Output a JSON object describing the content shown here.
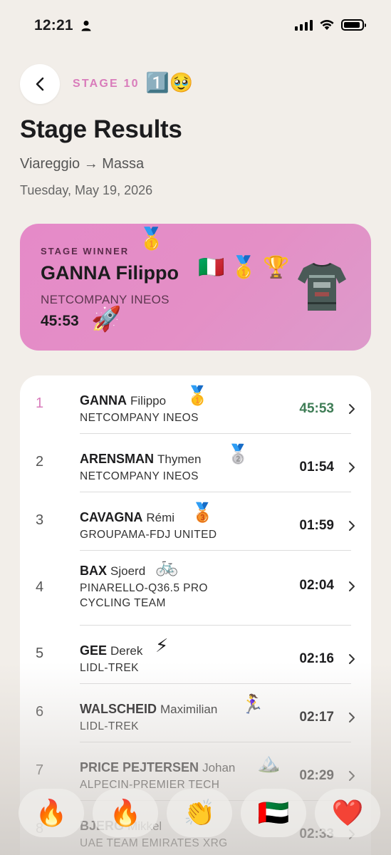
{
  "status_bar": {
    "time": "12:21",
    "battery_level": 0.9
  },
  "header": {
    "stage_label": "STAGE 10",
    "stage_emoji": "1️⃣🥹",
    "title": "Stage Results",
    "route": "Viareggio → Massa",
    "date": "Tuesday, May 19, 2026"
  },
  "winner": {
    "label": "STAGE WINNER",
    "label_medal": "🥇",
    "name": "GANNA Filippo",
    "emojis": "🇮🇹 🥇 🏆",
    "team": "NETCOMPANY INEOS",
    "time": "45:53",
    "time_emoji": "🚀"
  },
  "results": [
    {
      "rank": "1",
      "surname": "GANNA",
      "firstname": "Filippo",
      "emoji": "🥇",
      "team": "NETCOMPANY INEOS",
      "team2": "",
      "time": "45:53"
    },
    {
      "rank": "2",
      "surname": "ARENSMAN",
      "firstname": "Thymen",
      "emoji": "🥈",
      "team": "NETCOMPANY INEOS",
      "team2": "",
      "time": "01:54"
    },
    {
      "rank": "3",
      "surname": "CAVAGNA",
      "firstname": "Rémi",
      "emoji": "🥉",
      "team": "GROUPAMA-FDJ UNITED",
      "team2": "",
      "time": "01:59"
    },
    {
      "rank": "4",
      "surname": "BAX",
      "firstname": "Sjoerd",
      "emoji": "🚲",
      "team": "PINARELLO-Q36.5 PRO",
      "team2": "CYCLING TEAM",
      "time": "02:04"
    },
    {
      "rank": "5",
      "surname": "GEE",
      "firstname": "Derek",
      "emoji": "⚡",
      "team": "LIDL-TREK",
      "team2": "",
      "time": "02:16"
    },
    {
      "rank": "6",
      "surname": "WALSCHEID",
      "firstname": "Maximilian",
      "emoji": "🏃‍♀️",
      "team": "LIDL-TREK",
      "team2": "",
      "time": "02:17"
    },
    {
      "rank": "7",
      "surname": "PRICE PEJTERSEN",
      "firstname": "Johan",
      "emoji": "🏔️",
      "team": "ALPECIN-PREMIER TECH",
      "team2": "",
      "time": "02:29"
    },
    {
      "rank": "8",
      "surname": "BJERG",
      "firstname": "Mikkel",
      "emoji": "",
      "team": "UAE TEAM EMIRATES XRG",
      "team2": "",
      "time": "02:33"
    }
  ],
  "reactions": [
    "🔥",
    "🔥",
    "👏",
    "🇦🇪",
    "❤️"
  ]
}
